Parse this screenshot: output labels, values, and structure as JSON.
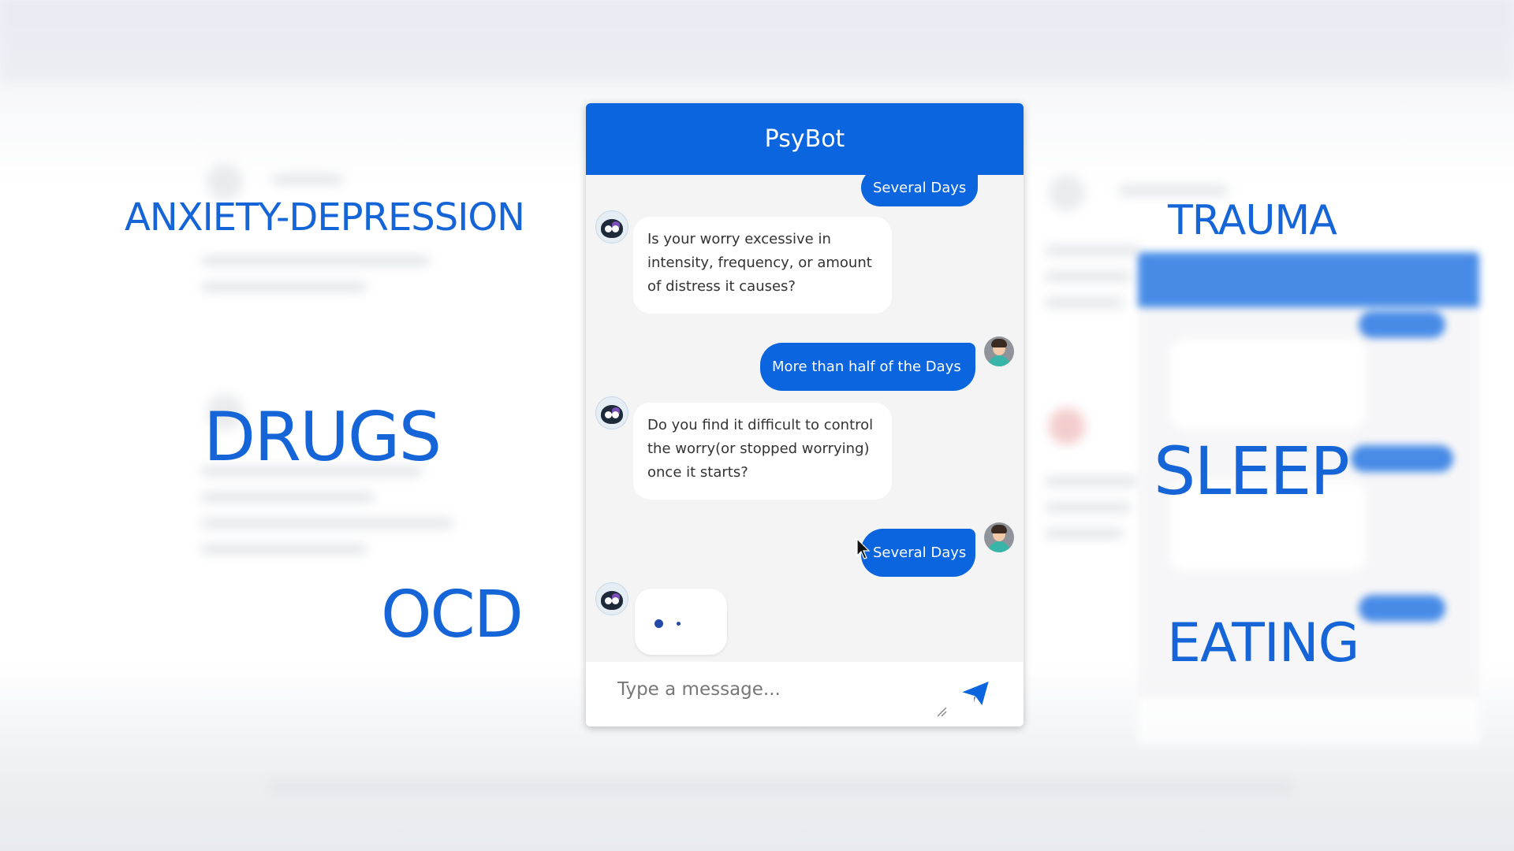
{
  "topics": {
    "anxiety": "ANXIETY-DEPRESSION",
    "drugs": "DRUGS",
    "ocd": "OCD",
    "trauma": "TRAUMA",
    "sleep": "SLEEP",
    "eating": "EATING"
  },
  "chat": {
    "title": "PsyBot",
    "messages": [
      {
        "sender": "user",
        "text": "Several Days"
      },
      {
        "sender": "bot",
        "text": "Is your worry excessive in intensity, frequency, or amount of distress it causes?"
      },
      {
        "sender": "user",
        "text": "More than half of the Days"
      },
      {
        "sender": "bot",
        "text": "Do you find it difficult to control the worry(or stopped worrying) once it starts?"
      },
      {
        "sender": "user",
        "text": "Several Days"
      }
    ],
    "typing_indicator": true,
    "input": {
      "placeholder": "Type a message...",
      "value": ""
    },
    "icons": {
      "send": "send-icon",
      "bot_avatar": "bot-avatar-icon",
      "user_avatar": "user-avatar-icon"
    }
  },
  "colors": {
    "accent": "#0a65df",
    "topic_text": "#1565d8",
    "bubble_bot": "#ffffff"
  }
}
